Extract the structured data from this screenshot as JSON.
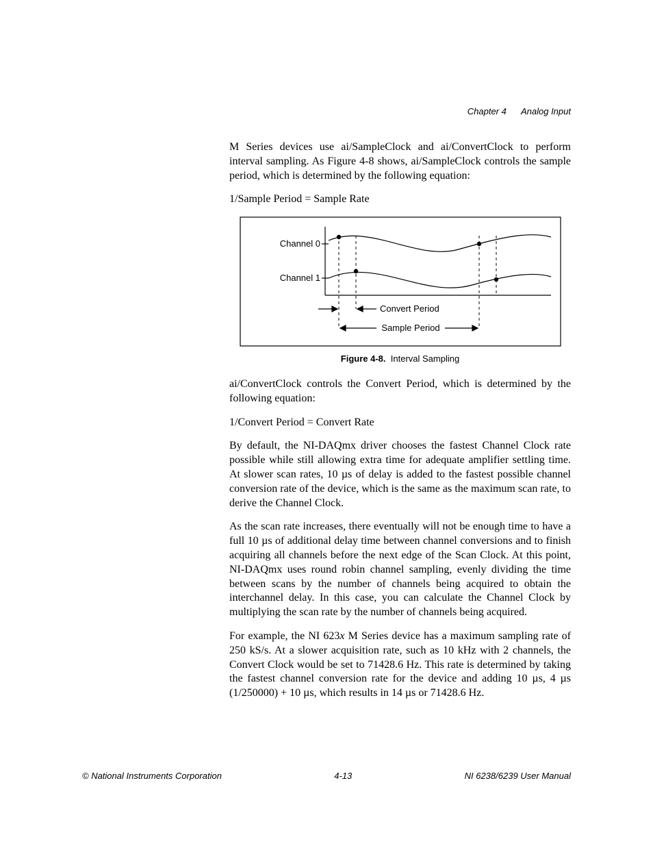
{
  "header": {
    "chapter": "Chapter 4",
    "section": "Analog Input"
  },
  "paragraphs": {
    "p1": "M Series devices use ai/SampleClock and ai/ConvertClock to perform interval sampling. As Figure 4-8 shows, ai/SampleClock controls the sample period, which is determined by the following equation:",
    "eq1": "1/Sample Period = Sample Rate",
    "p2": "ai/ConvertClock controls the Convert Period, which is determined by the following equation:",
    "eq2": "1/Convert Period = Convert Rate",
    "p3": "By default, the NI-DAQmx driver chooses the fastest Channel Clock rate possible while still allowing extra time for adequate amplifier settling time. At slower scan rates, 10 µs of delay is added to the fastest possible channel conversion rate of the device, which is the same as the maximum scan rate, to derive the Channel Clock.",
    "p4": "As the scan rate increases, there eventually will not be enough time to have a full 10 µs of additional delay time between channel conversions and to finish acquiring all channels before the next edge of the Scan Clock. At this point, NI-DAQmx uses round robin channel sampling, evenly dividing the time between scans by the number of channels being acquired to obtain the interchannel delay. In this case, you can calculate the Channel Clock by multiplying the scan rate by the number of channels being acquired.",
    "p5a": "For example, the NI 623",
    "p5x": "x",
    "p5b": " M Series device has a maximum sampling rate of 250 kS/s. At a slower acquisition rate, such as 10 kHz with 2 channels, the Convert Clock would be set to 71428.6 Hz. This rate is determined by taking the fastest channel conversion rate for the device and adding 10 µs, 4 µs (1/250000) + 10 µs, which results in 14 µs or 71428.6 Hz."
  },
  "figure": {
    "caption_label": "Figure 4-8.",
    "caption_text": "Interval Sampling",
    "labels": {
      "channel0": "Channel 0",
      "channel1": "Channel 1",
      "convert_period": "Convert Period",
      "sample_period": "Sample Period"
    }
  },
  "footer": {
    "left": "© National Instruments Corporation",
    "center": "4-13",
    "right": "NI 6238/6239 User Manual"
  }
}
